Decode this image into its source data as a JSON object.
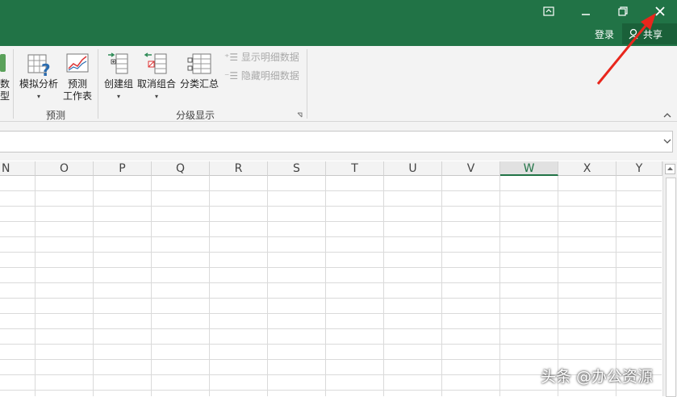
{
  "titlebar": {
    "login_label": "登录",
    "share_label": "共享",
    "accent": "#217346"
  },
  "ribbon": {
    "partial_left_labels": [
      "数",
      "型"
    ],
    "whatif_label": "模拟分析",
    "forecast_label_line1": "预测",
    "forecast_label_line2": "工作表",
    "group_forecast_label": "预测",
    "group_label": "创建组",
    "ungroup_label": "取消组合",
    "subtotal_label": "分类汇总",
    "show_detail_label": "显示明细数据",
    "hide_detail_label": "隐藏明细数据",
    "group_outline_label": "分级显示"
  },
  "sheet": {
    "columns": [
      "N",
      "O",
      "P",
      "Q",
      "R",
      "S",
      "T",
      "U",
      "V",
      "W",
      "X",
      "Y"
    ],
    "selected_column": "W"
  },
  "watermark": "头条 @办公资源"
}
